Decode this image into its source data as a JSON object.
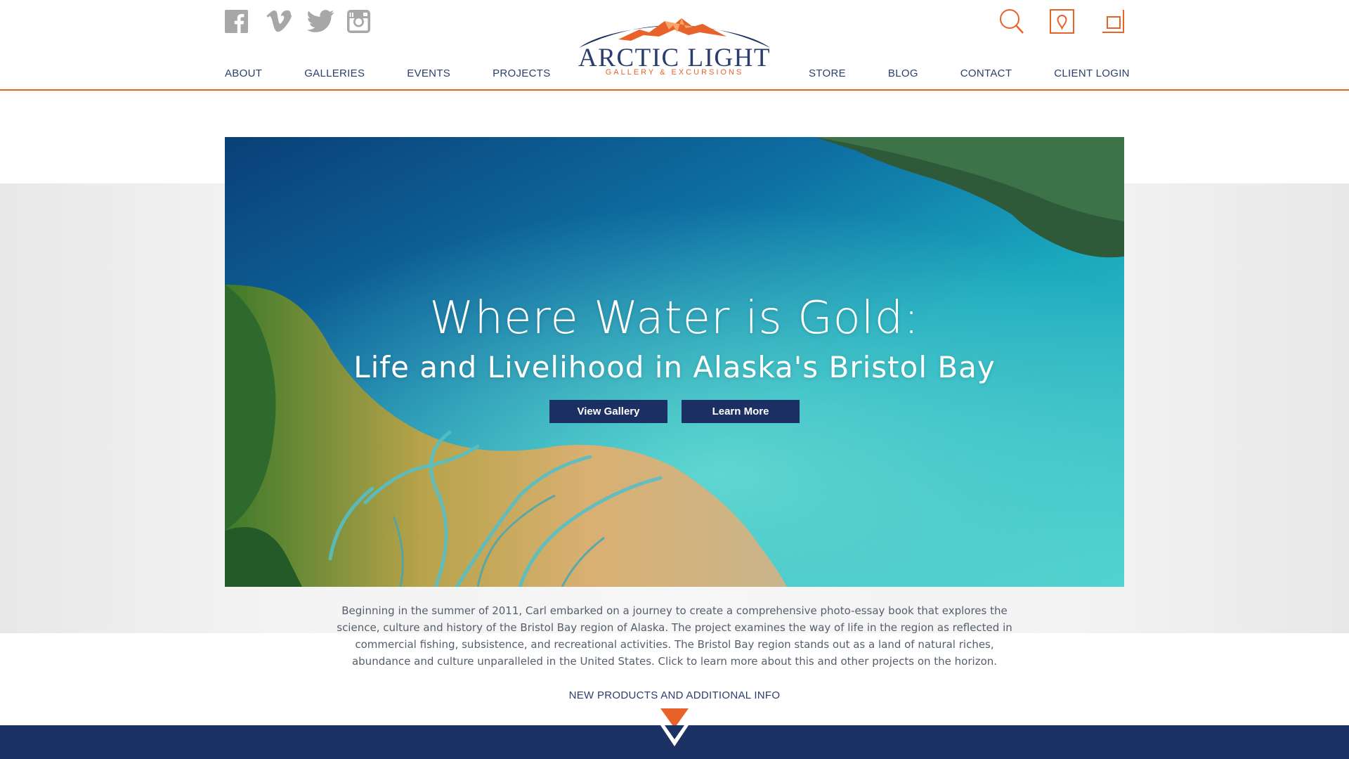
{
  "brand": {
    "name": "ARCTIC LIGHT",
    "tagline": "GALLERY & EXCURSIONS",
    "colors": {
      "navy": "#1c3265",
      "orange": "#e8632a",
      "gray_icon": "#a7a7a7"
    }
  },
  "social": [
    {
      "icon": "facebook-icon"
    },
    {
      "icon": "vimeo-icon"
    },
    {
      "icon": "twitter-icon"
    },
    {
      "icon": "instagram-icon"
    }
  ],
  "utility": [
    {
      "icon": "search-icon"
    },
    {
      "icon": "map-pin-icon"
    },
    {
      "icon": "cart-icon"
    }
  ],
  "nav": {
    "left": [
      "ABOUT",
      "GALLERIES",
      "EVENTS",
      "PROJECTS"
    ],
    "right": [
      "STORE",
      "BLOG",
      "CONTACT",
      "CLIENT LOGIN"
    ]
  },
  "hero": {
    "title": "Where Water is Gold:",
    "subtitle": "Life and Livelihood in Alaska's Bristol Bay",
    "buttons": {
      "view_gallery": "View Gallery",
      "learn_more": "Learn More"
    }
  },
  "description": "Beginning in the summer of 2011, Carl embarked on a journey to create a comprehensive photo-essay book that explores the science, culture and history of the Bristol Bay region of Alaska. The project examines the way of life in the region as reflected in commercial fishing, subsistence, and recreational activities. The Bristol Bay region stands out as a land of natural riches, abundance and culture unparalleled in the United States. Click to learn more about this and other projects on the horizon.",
  "more_link": "NEW PRODUCTS AND ADDITIONAL INFO"
}
